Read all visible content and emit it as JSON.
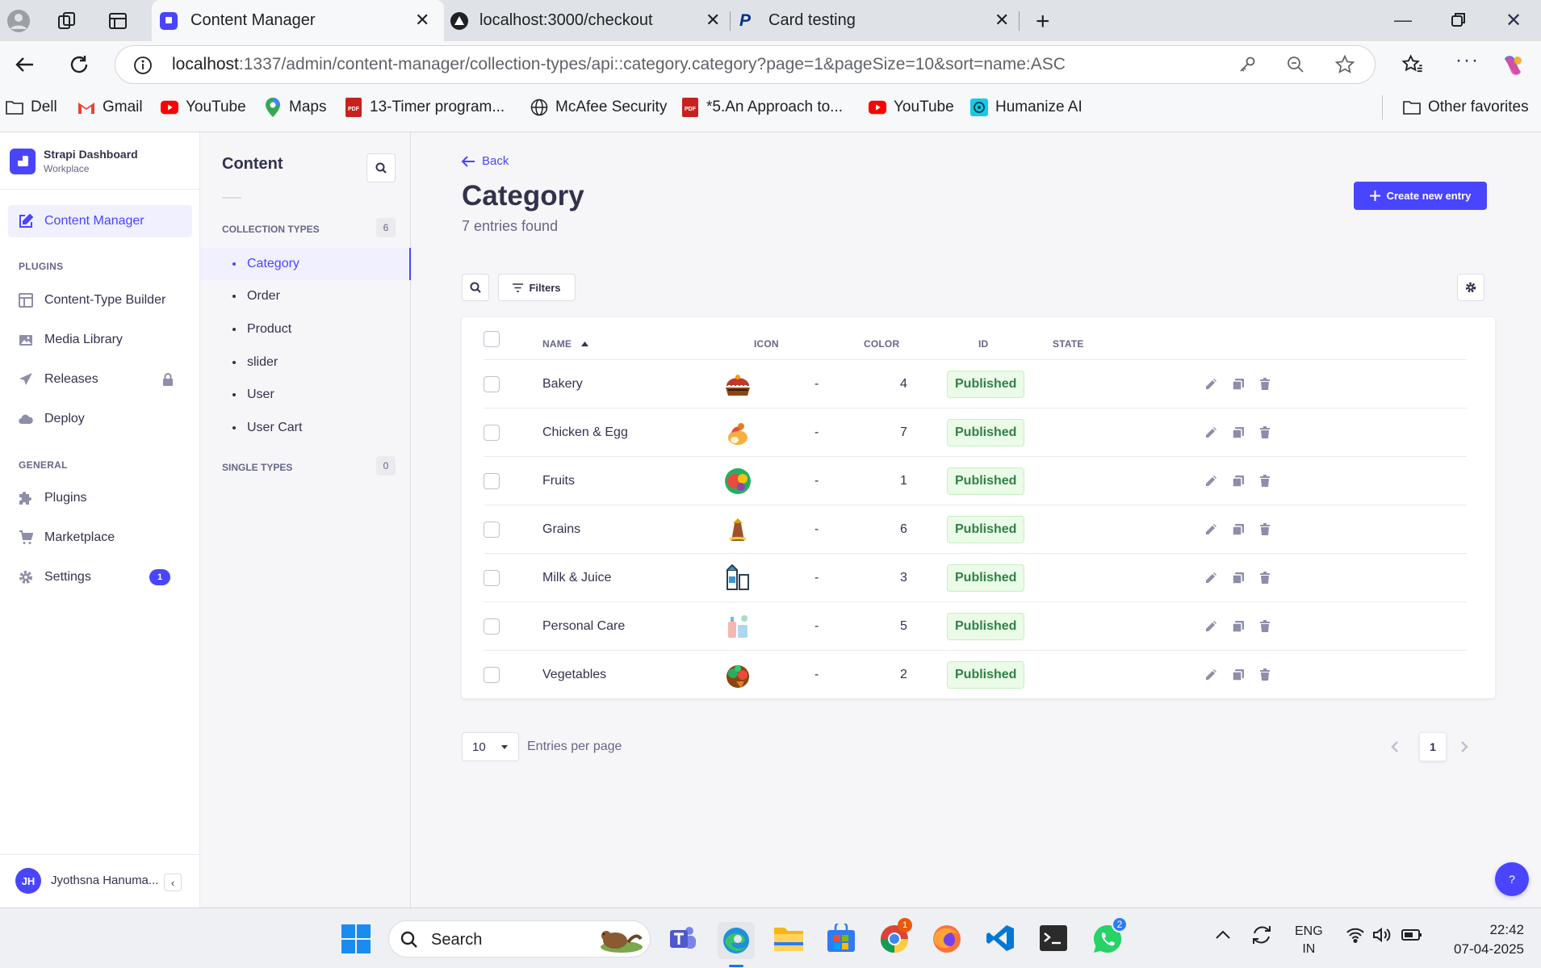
{
  "browser": {
    "tabs": [
      {
        "title": "Content Manager",
        "active": true
      },
      {
        "title": "localhost:3000/checkout",
        "active": false
      },
      {
        "title": "Card testing",
        "active": false
      }
    ],
    "url_host": "localhost",
    "url_rest": ":1337/admin/content-manager/collection-types/api::category.category?page=1&pageSize=10&sort=name:ASC",
    "bookmarks": [
      "Dell",
      "Gmail",
      "YouTube",
      "Maps",
      "13-Timer program...",
      "McAfee Security",
      "*5.An Approach to...",
      "YouTube",
      "Humanize AI"
    ],
    "other_favorites": "Other favorites"
  },
  "nav": {
    "brand_title": "Strapi Dashboard",
    "brand_sub": "Workplace",
    "content_manager": "Content Manager",
    "plugins_heading": "PLUGINS",
    "plugins": [
      "Content-Type Builder",
      "Media Library",
      "Releases",
      "Deploy"
    ],
    "general_heading": "GENERAL",
    "general": [
      "Plugins",
      "Marketplace",
      "Settings"
    ],
    "settings_badge": "1",
    "user_initials": "JH",
    "user_name": "Jyothsna Hanuma..."
  },
  "sub": {
    "title": "Content",
    "collection_heading": "COLLECTION TYPES",
    "collection_count": "6",
    "collections": [
      "Category",
      "Order",
      "Product",
      "slider",
      "User",
      "User Cart"
    ],
    "single_heading": "SINGLE TYPES",
    "single_count": "0"
  },
  "main": {
    "back": "Back",
    "title": "Category",
    "subtitle": "7 entries found",
    "create_button": "Create new entry",
    "filters": "Filters",
    "columns": [
      "NAME",
      "ICON",
      "COLOR",
      "ID",
      "STATE"
    ],
    "rows": [
      {
        "name": "Bakery",
        "color": "-",
        "id": "4",
        "state": "Published",
        "icon": "bakery-icon"
      },
      {
        "name": "Chicken & Egg",
        "color": "-",
        "id": "7",
        "state": "Published",
        "icon": "chicken-egg-icon"
      },
      {
        "name": "Fruits",
        "color": "-",
        "id": "1",
        "state": "Published",
        "icon": "fruits-icon"
      },
      {
        "name": "Grains",
        "color": "-",
        "id": "6",
        "state": "Published",
        "icon": "grains-icon"
      },
      {
        "name": "Milk & Juice",
        "color": "-",
        "id": "3",
        "state": "Published",
        "icon": "milk-juice-icon"
      },
      {
        "name": "Personal Care",
        "color": "-",
        "id": "5",
        "state": "Published",
        "icon": "personal-care-icon"
      },
      {
        "name": "Vegetables",
        "color": "-",
        "id": "2",
        "state": "Published",
        "icon": "vegetables-icon"
      }
    ],
    "page_size": "10",
    "entries_per_page": "Entries per page",
    "page": "1",
    "help": "?"
  },
  "taskbar": {
    "search": "Search",
    "lang1": "ENG",
    "lang2": "IN",
    "time": "22:42",
    "date": "07-04-2025",
    "chrome_badge": "1",
    "whatsapp_badge": "2"
  },
  "colors": {
    "accent": "#4945ff",
    "published_bg": "#eafbe7",
    "published_text": "#328048",
    "text": "#32324d",
    "muted": "#666687"
  }
}
